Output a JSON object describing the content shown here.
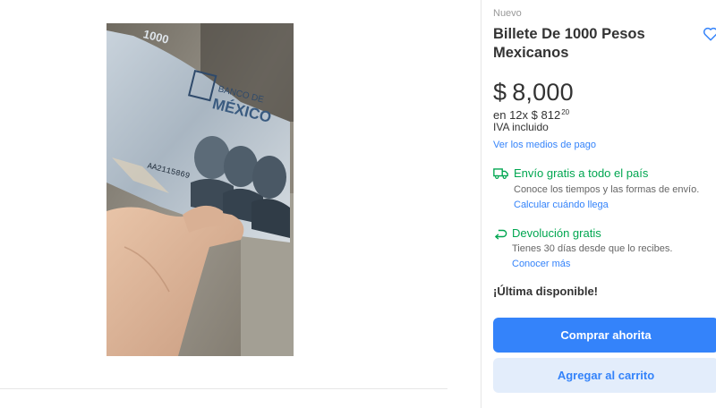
{
  "product": {
    "condition": "Nuevo",
    "title": "Billete De 1000 Pesos Mexicanos",
    "price_currency": "$",
    "price_amount": "8,000",
    "installments_prefix": "en 12x $ 812",
    "installments_cents": "20",
    "tax_note": "IVA incluido",
    "payment_methods_link": "Ver los medios de pago"
  },
  "shipping": {
    "headline": "Envío gratis a todo el país",
    "description": "Conoce los tiempos y las formas de envío.",
    "link": "Calcular cuándo llega",
    "icon": "truck-icon"
  },
  "returns": {
    "headline": "Devolución gratis",
    "description": "Tienes 30 días desde que lo recibes.",
    "link": "Conocer más",
    "icon": "return-arrow-icon"
  },
  "stock": {
    "label": "¡Última disponible!"
  },
  "actions": {
    "buy_now": "Comprar ahorita",
    "add_to_cart": "Agregar al carrito"
  },
  "banknote": {
    "denomination": "1000",
    "issuer_line1": "BANCO DE",
    "issuer_line2": "MÉXICO",
    "serial": "AA2115869"
  },
  "colors": {
    "accent": "#3483fa",
    "accent_light": "#e3edfb",
    "success": "#00a650",
    "text": "#333333",
    "muted": "#999999"
  }
}
